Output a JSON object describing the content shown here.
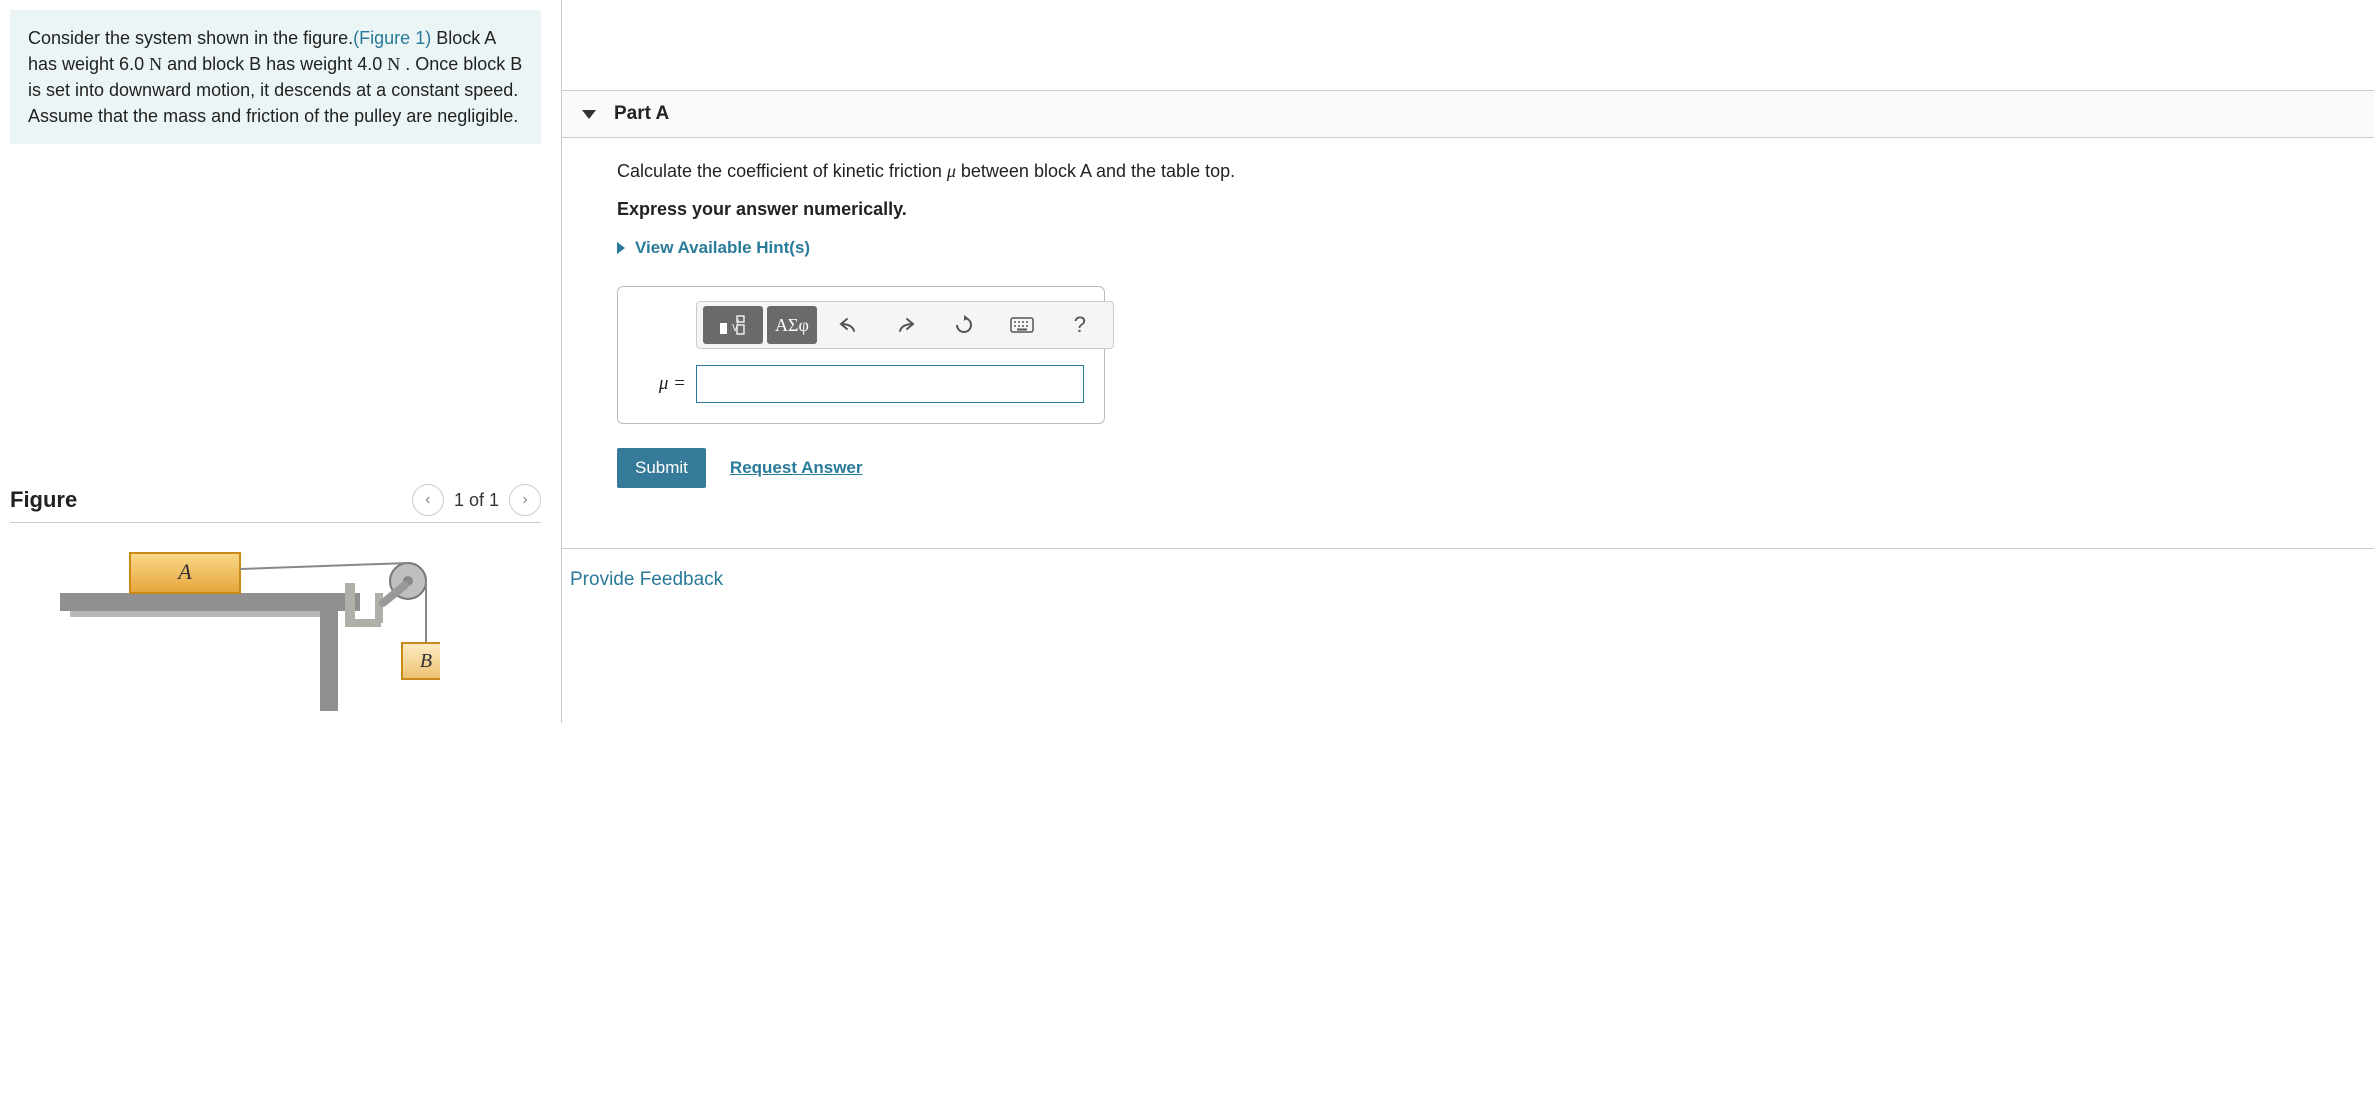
{
  "problem": {
    "text_before_fig": "Consider the system shown in the figure.",
    "figure_link_text": "(Figure 1)",
    "text_seg2": " Block A has weight 6.0 ",
    "unit1": "N",
    "text_seg3": " and block B has weight 4.0 ",
    "unit2": "N",
    "text_seg4": " . Once block B is set into downward motion, it descends at a constant speed. Assume that the mass and friction of the pulley are negligible."
  },
  "figure": {
    "title": "Figure",
    "pager": "1 of 1",
    "labels": {
      "blockA": "A",
      "blockB": "B"
    }
  },
  "part": {
    "title": "Part A",
    "question_before_mu": "Calculate the coefficient of kinetic friction ",
    "mu_symbol": "μ",
    "question_after_mu": " between block A and the table top.",
    "express": "Express your answer numerically.",
    "hints_label": "View Available Hint(s)",
    "toolbar": {
      "math_templates": "math-templates",
      "greek": "ΑΣφ",
      "undo": "undo",
      "redo": "redo",
      "reset": "reset",
      "keyboard": "keyboard",
      "help": "?"
    },
    "input_label": "μ =",
    "submit": "Submit",
    "request_answer": "Request Answer"
  },
  "feedback": "Provide Feedback"
}
